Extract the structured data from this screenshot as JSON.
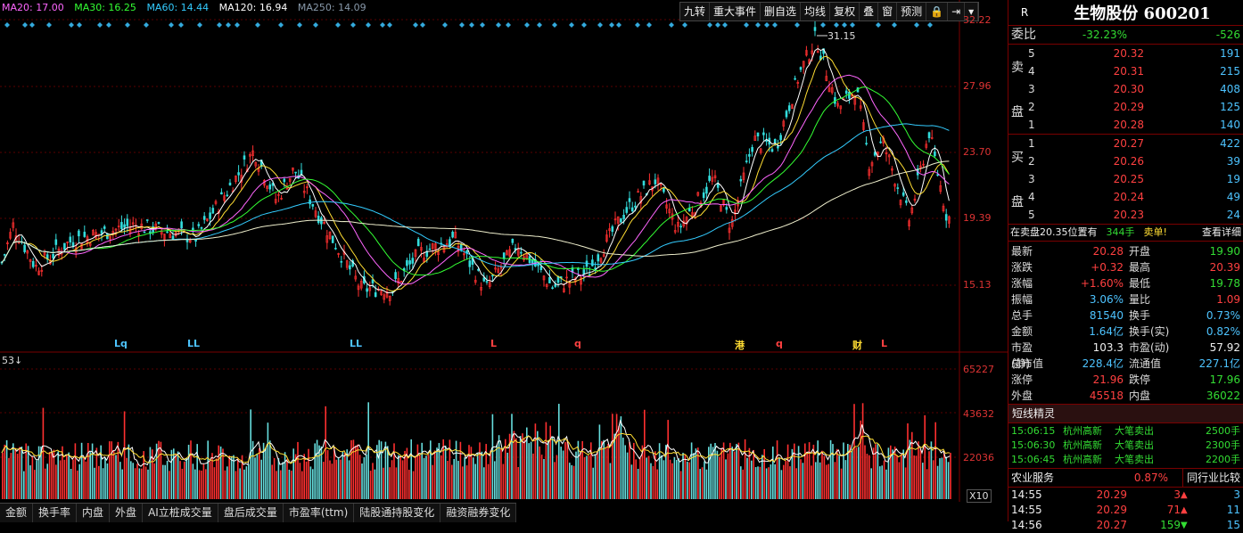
{
  "ma": [
    {
      "label": "MA20: 17.00",
      "color": "#ff66ff"
    },
    {
      "label": "MA30: 16.25",
      "color": "#33ff33"
    },
    {
      "label": "MA60: 14.44",
      "color": "#33ccff"
    },
    {
      "label": "MA120: 16.94",
      "color": "#ffffff"
    },
    {
      "label": "MA250: 14.09",
      "color": "#8899aa"
    }
  ],
  "toolbar": [
    "九转",
    "重大事件",
    "删自选",
    "均线",
    "复权",
    "叠",
    "窗",
    "预测"
  ],
  "price_axis": [
    "32.22",
    "27.96",
    "23.70",
    "19.39",
    "15.13"
  ],
  "volume_axis": [
    "65227",
    "43632",
    "22036"
  ],
  "high_marker": "31.15",
  "volume_label": "53↓",
  "volume_unit": "X10",
  "event_markers": [
    "Lq",
    "LL",
    "LL",
    "L",
    "q",
    "港",
    "q",
    "财",
    "L"
  ],
  "bottom_tabs": [
    "金额",
    "换手率",
    "内盘",
    "外盘",
    "AI立桩成交量",
    "盘后成交量",
    "市盈率(ttm)",
    "陆股通持股变化",
    "融资融券变化"
  ],
  "stock": {
    "r_tag": "R",
    "name": "生物股份 600201"
  },
  "weibi": {
    "label": "委比",
    "pct": "-32.23%",
    "diff": "-526"
  },
  "sell_side_label": "卖盘",
  "buy_side_label": "买盘",
  "sell": [
    {
      "lv": "5",
      "price": "20.32",
      "vol": "191"
    },
    {
      "lv": "4",
      "price": "20.31",
      "vol": "215"
    },
    {
      "lv": "3",
      "price": "20.30",
      "vol": "408"
    },
    {
      "lv": "2",
      "price": "20.29",
      "vol": "125"
    },
    {
      "lv": "1",
      "price": "20.28",
      "vol": "140"
    }
  ],
  "buy": [
    {
      "lv": "1",
      "price": "20.27",
      "vol": "422"
    },
    {
      "lv": "2",
      "price": "20.26",
      "vol": "39"
    },
    {
      "lv": "3",
      "price": "20.25",
      "vol": "19"
    },
    {
      "lv": "4",
      "price": "20.24",
      "vol": "49"
    },
    {
      "lv": "5",
      "price": "20.23",
      "vol": "24"
    }
  ],
  "order_note": {
    "text": "在卖盘20.35位置有",
    "qty": "344手",
    "tag": "卖单!",
    "link": "查看详细"
  },
  "quote": [
    {
      "l1": "最新",
      "v1": "20.28",
      "c1": "red",
      "l2": "开盘",
      "v2": "19.90",
      "c2": "green"
    },
    {
      "l1": "涨跌",
      "v1": "+0.32",
      "c1": "red",
      "l2": "最高",
      "v2": "20.39",
      "c2": "red"
    },
    {
      "l1": "涨幅",
      "v1": "+1.60%",
      "c1": "red",
      "l2": "最低",
      "v2": "19.78",
      "c2": "green"
    },
    {
      "l1": "振幅",
      "v1": "3.06%",
      "c1": "cyan",
      "l2": "量比",
      "v2": "1.09",
      "c2": "red"
    },
    {
      "l1": "总手",
      "v1": "81540",
      "c1": "cyan",
      "l2": "换手",
      "v2": "0.73%",
      "c2": "cyan"
    },
    {
      "l1": "金额",
      "v1": "1.64亿",
      "c1": "cyan",
      "l2": "换手(实)",
      "v2": "0.82%",
      "c2": "cyan"
    },
    {
      "l1": "市盈(静)",
      "v1": "103.3",
      "c1": "white",
      "l2": "市盈(动)",
      "v2": "57.92",
      "c2": "white"
    },
    {
      "l1": "总市值",
      "v1": "228.4亿",
      "c1": "cyan",
      "l2": "流通值",
      "v2": "227.1亿",
      "c2": "cyan"
    },
    {
      "l1": "涨停",
      "v1": "21.96",
      "c1": "red",
      "l2": "跌停",
      "v2": "17.96",
      "c2": "green"
    },
    {
      "l1": "外盘",
      "v1": "45518",
      "c1": "red",
      "l2": "内盘",
      "v2": "36022",
      "c2": "green"
    }
  ],
  "spirit": {
    "title": "短线精灵",
    "items": [
      {
        "time": "15:06:15",
        "name": "杭州高新",
        "event": "大笔卖出",
        "qty": "2500手"
      },
      {
        "time": "15:06:30",
        "name": "杭州高新",
        "event": "大笔卖出",
        "qty": "2300手"
      },
      {
        "time": "15:06:45",
        "name": "杭州高新",
        "event": "大笔卖出",
        "qty": "2200手"
      }
    ]
  },
  "industry": {
    "name": "农业服务",
    "pct": "0.87%",
    "btn": "同行业比较"
  },
  "ticks": [
    {
      "time": "14:55",
      "price": "20.29",
      "pc": "red",
      "vol": "3",
      "dir": "up",
      "n": "3"
    },
    {
      "time": "14:55",
      "price": "20.29",
      "pc": "red",
      "vol": "71",
      "dir": "up",
      "n": "11"
    },
    {
      "time": "14:56",
      "price": "20.27",
      "pc": "red",
      "vol": "159",
      "dir": "down",
      "n": "15"
    }
  ]
}
